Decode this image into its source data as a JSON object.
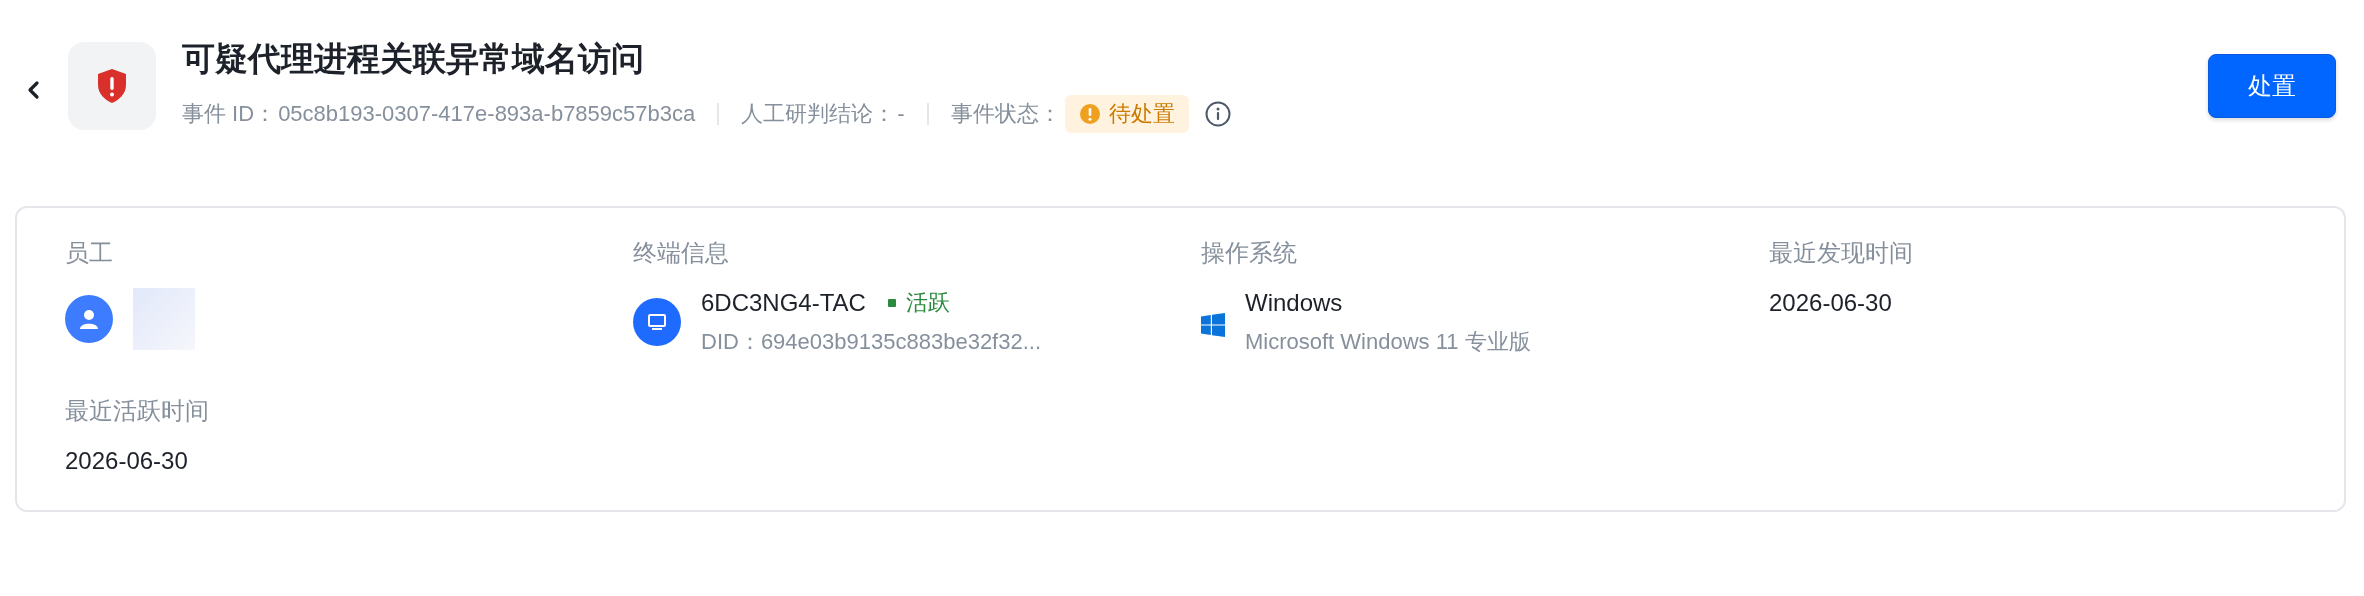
{
  "header": {
    "title": "可疑代理进程关联异常域名访问",
    "meta": [
      {
        "label": "事件 ID：",
        "value": "05c8b193-0307-417e-893a-b7859c57b3ca"
      },
      {
        "label": "人工研判结论：",
        "value": "-"
      }
    ],
    "status": {
      "label": "事件状态：",
      "value": "待处置"
    },
    "action": "处置"
  },
  "fields": [
    {
      "kind": "employee",
      "label": "员工"
    },
    {
      "kind": "terminal",
      "label": "终端信息",
      "name": "6DC3NG4-TAC",
      "status": {
        "label": "活跃",
        "active": true
      },
      "detail": "DID：694e03b9135c883be32f32..."
    },
    {
      "kind": "os",
      "label": "操作系统",
      "name": "Windows",
      "detail": "Microsoft Windows 11 专业版"
    },
    {
      "kind": "text",
      "label": "最近发现时间",
      "value": "2026-06-30"
    },
    {
      "kind": "text",
      "label": "最近活跃时间",
      "value": "2026-06-30"
    }
  ]
}
